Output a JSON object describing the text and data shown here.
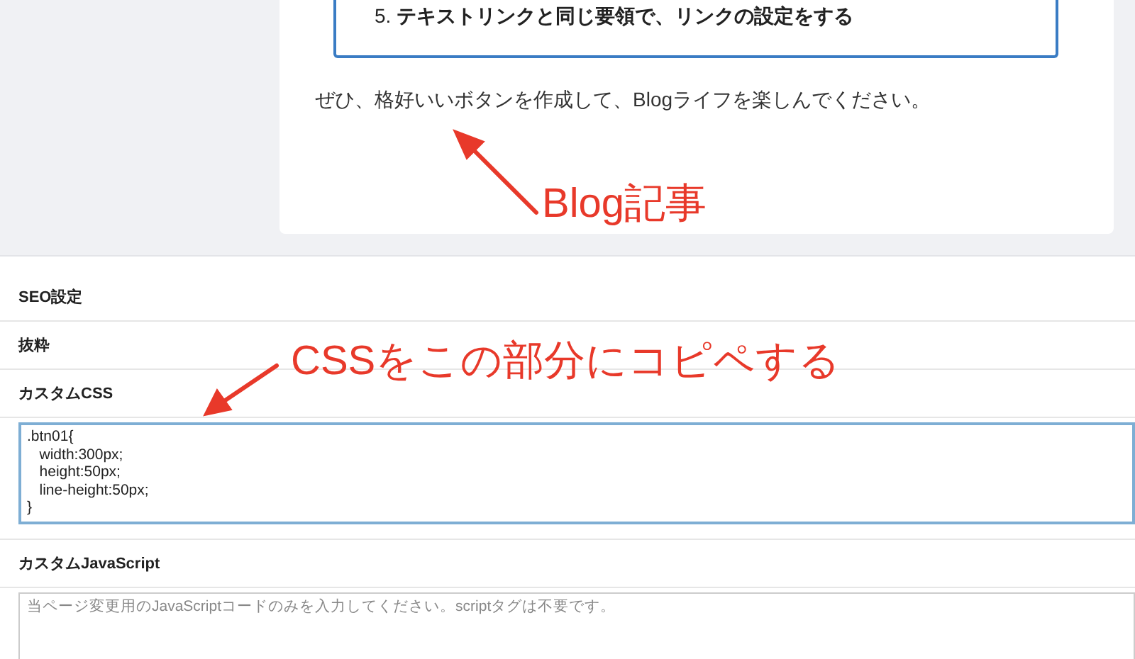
{
  "article": {
    "list_items": [
      {
        "number": "5.",
        "text": "テキストリンクと同じ要領で、リンクの設定をする"
      }
    ],
    "paragraph": "ぜひ、格好いいボタンを作成して、Blogライフを楽しんでください。"
  },
  "settings": [
    {
      "label": "SEO設定"
    },
    {
      "label": "抜粋"
    },
    {
      "label": "カスタムCSS",
      "field": {
        "value": ".btn01{\n   width:300px;\n   height:50px;\n   line-height:50px;\n}",
        "focused": true
      }
    },
    {
      "label": "カスタムJavaScript",
      "field": {
        "placeholder": "当ページ変更用のJavaScriptコードのみを入力してください。scriptタグは不要です。",
        "focused": false
      }
    }
  ],
  "annotations": [
    {
      "text": "Blog記事"
    },
    {
      "text": "CSSをこの部分にコピペする"
    }
  ]
}
